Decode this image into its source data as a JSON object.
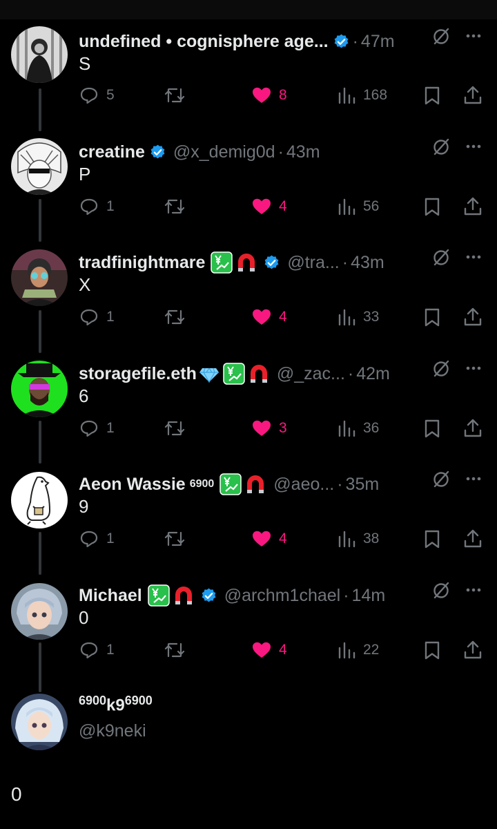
{
  "colors": {
    "background": "#000000",
    "text": "#e7e9ea",
    "muted": "#71767b",
    "like": "#f91880",
    "verified": "#1d9bf0",
    "thread_line": "#333639"
  },
  "tweets": [
    {
      "name": "undefined • cognisphere age...",
      "verified": true,
      "handle": "",
      "dot": "·",
      "time": "47m",
      "text": "S",
      "replies": "5",
      "likes": "8",
      "views": "168",
      "liked": true
    },
    {
      "name": "creatine",
      "verified": true,
      "handle": "@x_demig0d",
      "dot": "·",
      "time": "43m",
      "text": "P",
      "replies": "1",
      "likes": "4",
      "views": "56",
      "liked": true
    },
    {
      "name": "tradfinightmare",
      "verified": true,
      "handle": "@tra...",
      "dot": "·",
      "time": "43m",
      "text": "X",
      "replies": "1",
      "likes": "4",
      "views": "33",
      "liked": true
    },
    {
      "name": "storagefile.eth",
      "verified": false,
      "handle": "@_zac...",
      "dot": "·",
      "time": "42m",
      "text": "6",
      "replies": "1",
      "likes": "3",
      "views": "36",
      "liked": true
    },
    {
      "name": "Aeon Wassie",
      "name_sup": "6900",
      "verified": false,
      "handle": "@aeo...",
      "dot": "·",
      "time": "35m",
      "text": "9",
      "replies": "1",
      "likes": "4",
      "views": "38",
      "liked": true
    },
    {
      "name": "Michael",
      "verified": true,
      "handle": "@archm1chael",
      "dot": "·",
      "time": "14m",
      "text": "0",
      "replies": "1",
      "likes": "4",
      "views": "22",
      "liked": true
    }
  ],
  "last_tweet": {
    "name_pre": "6900",
    "name_mid": "k9",
    "name_post": "6900",
    "handle": "@k9neki",
    "text": "0"
  },
  "icons": {
    "reply": "reply-icon",
    "retweet": "retweet-icon",
    "like": "heart-icon",
    "views": "views-icon",
    "bookmark": "bookmark-icon",
    "share": "share-icon",
    "grok": "grok-icon",
    "more": "more-icon",
    "verified": "verified-badge-icon",
    "chart_emoji": "chart-yen-emoji",
    "magnet_emoji": "magnet-emoji",
    "diamond_emoji": "gem-emoji"
  }
}
